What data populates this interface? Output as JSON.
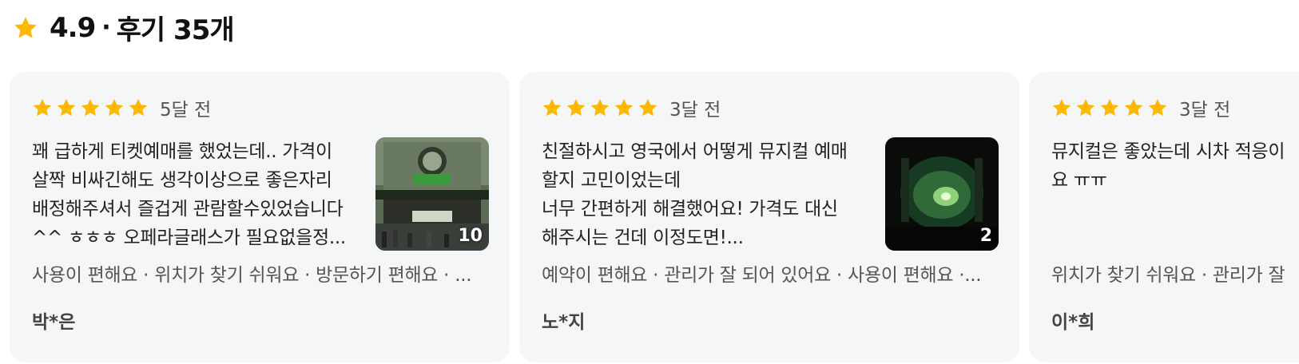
{
  "header": {
    "rating": "4.9",
    "separator": "·",
    "review_count": "후기 35개",
    "star_color": "#FFB800"
  },
  "reviews": [
    {
      "rating": 5,
      "time_ago": "5달 전",
      "text": "꽤 급하게 티켓예매를 했었는데.. 가격이\n살짝 비싸긴해도 생각이상으로 좋은자리\n배정해주셔서 즐겁게 관람할수있었습니다\n^^ ㅎㅎㅎ 오페라글래스가 필요없을정...",
      "photo_count": "10",
      "tags": "사용이 편해요 · 위치가 찾기 쉬워요 · 방문하기 편해요 · ...",
      "reviewer": "박*은"
    },
    {
      "rating": 5,
      "time_ago": "3달 전",
      "text": "친절하시고 영국에서 어떻게 뮤지컬 예매\n할지 고민이었는데\n너무 간편하게 해결했어요! 가격도 대신\n해주시는 건데 이정도면!...",
      "photo_count": "2",
      "tags": "예약이 편해요 · 관리가 잘 되어 있어요 · 사용이 편해요 ·...",
      "reviewer": "노*지"
    },
    {
      "rating": 5,
      "time_ago": "3달 전",
      "text": "뮤지컬은 좋았는데 시차 적응이\n요 ㅠㅠ",
      "tags": "위치가 찾기 쉬워요 · 관리가 잘",
      "reviewer": "이*희"
    }
  ]
}
